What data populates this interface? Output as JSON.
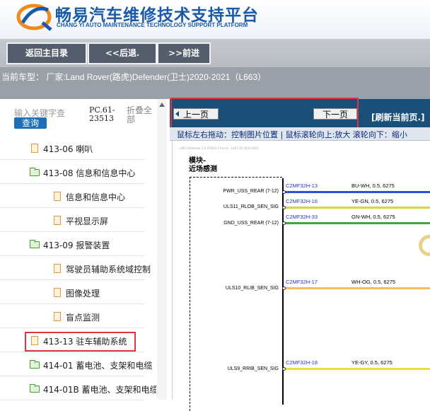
{
  "brand": {
    "title": "畅易汽车维修技术支持平台",
    "subtitle": "CHANG YI AUTO MAINTENANCE TECHNOLOGY SUPPORT PLATFORM"
  },
  "toolbar": {
    "back_main": "返回主目录",
    "back": "<<后退.",
    "forward": ">>前进"
  },
  "vehicle": {
    "info": "当前车型： 厂家:Land Rover(路虎)Defender(卫士)2020-2021（L663）"
  },
  "left_panel": {
    "search_placeholder": "输入关键字查",
    "search_button": "查询",
    "pc_code_line1": "PC.61-",
    "pc_code_line2": "23513",
    "collapse_all": "折叠全部",
    "tree": [
      {
        "label": "413-06 喇叭",
        "icon": "file-icon"
      },
      {
        "label": "413-08 信息和信息中心",
        "icon": "folder-open-icon"
      },
      {
        "label": "信息和信息中心",
        "icon": "file-icon"
      },
      {
        "label": "平视显示屏",
        "icon": "file-icon"
      },
      {
        "label": "413-09 报警装置",
        "icon": "folder-open-icon"
      },
      {
        "label": "驾驶员辅助系统域控制",
        "icon": "file-icon"
      },
      {
        "label": "图像处理",
        "icon": "file-icon"
      },
      {
        "label": "盲点监测",
        "icon": "file-icon"
      },
      {
        "label": "413-13 驻车辅助系统",
        "icon": "file-icon",
        "selected": true
      },
      {
        "label": "414-01 蓄电池、支架和电缆",
        "icon": "folder-icon"
      },
      {
        "label": "414-01B 蓄电池、支架和电缆",
        "icon": "folder-icon"
      }
    ]
  },
  "viewer": {
    "prev_page": "上一页",
    "next_page": "下一页",
    "refresh": "[刷新当前页.]",
    "hint": "鼠标左右拖动：控制图片位置 | 鼠标滚轮向上:放大  滚轮向下：缩小",
    "diagram": {
      "header_small": "L663 Defender 2.0 (PHEV) Chassis - L663 20 2020-2021",
      "module_line1": "模块-",
      "module_line2": "近场感测",
      "pins": [
        {
          "pin": "PWR_USS_REAR (7-12)",
          "connector": "C2MF32H-13",
          "spec": "BU-WH,  0.5,  6275",
          "color": "#2e4fd8"
        },
        {
          "pin": "ULS11_RLOB_SEN_SIG",
          "connector": "C2MF32H-16",
          "spec": "YE-GN,  0.5,  6275",
          "color": "#d8d838"
        },
        {
          "pin": "GND_USS_REAR (7-12)",
          "connector": "C2MF32H-33",
          "spec": "GN-WH,  0.5,  6275",
          "color": "#3aa846"
        },
        {
          "pin": "ULS10_RLIB_SEN_SIG",
          "connector": "C2MF32H-17",
          "spec": "WH-OG,  0.5,  6275",
          "color": "#f0c060"
        },
        {
          "pin": "ULS9_RRIB_SEN_SIG",
          "connector": "C2MF32H-18",
          "spec": "YE-GY,  0.5,  6275",
          "color": "#e6e040"
        }
      ]
    }
  },
  "colors": {
    "brand_blue": "#1a5aa8",
    "toolbar_button": "#545d6b",
    "nav_blue": "#1a4f7a",
    "highlight_red": "#d9363e"
  }
}
